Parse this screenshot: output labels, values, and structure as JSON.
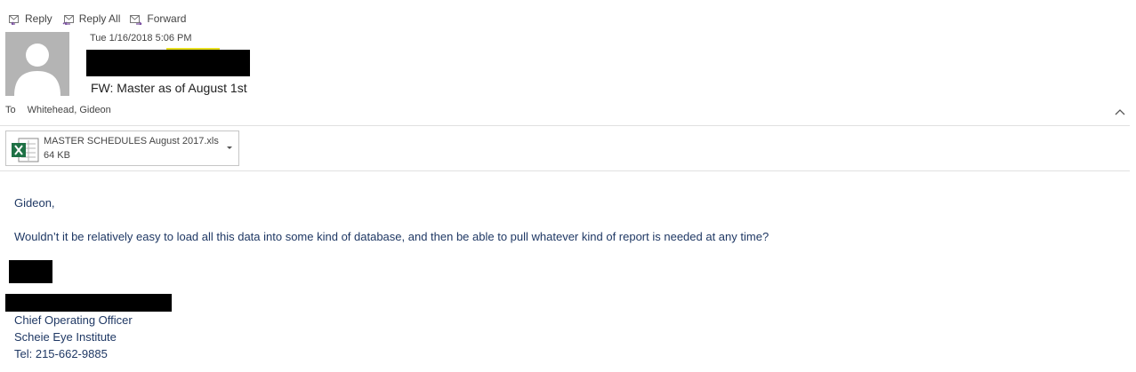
{
  "toolbar": {
    "reply_label": "Reply",
    "reply_all_label": "Reply All",
    "forward_label": "Forward"
  },
  "message": {
    "sent_date": "Tue 1/16/2018 5:06 PM",
    "subject": "FW: Master as of August 1st",
    "to_label": "To",
    "to_value": "Whitehead, Gideon"
  },
  "attachment": {
    "name": "MASTER SCHEDULES August 2017.xls",
    "size": "64 KB"
  },
  "body": {
    "greeting": "Gideon,",
    "paragraph": "Wouldn’t it be relatively easy to load all this data into some kind of database, and then be able to pull whatever kind of report is needed at any time?",
    "signature_title": "Chief Operating Officer",
    "signature_org": "Scheie Eye Institute",
    "signature_phone": "Tel:  215-662-9885"
  },
  "colors": {
    "body_text": "#1f3864",
    "header_text": "#444444",
    "icon_accent": "#7a4fa0",
    "excel_green": "#1e7145",
    "avatar_bg": "#b4b4b4"
  },
  "icons": {
    "reply": "reply-icon",
    "reply_all": "reply-all-icon",
    "forward": "forward-icon",
    "attachment": "excel-file-icon",
    "collapse": "chevron-up-icon",
    "attachment_menu": "chevron-down-icon"
  }
}
